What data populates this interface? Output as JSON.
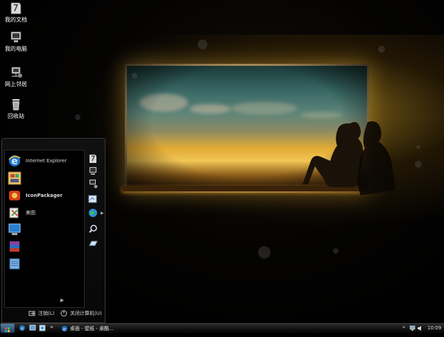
{
  "desktop_icons": [
    {
      "label": "我的文档",
      "icon": "my-documents-icon"
    },
    {
      "label": "我的电脑",
      "icon": "my-computer-icon"
    },
    {
      "label": "网上邻居",
      "icon": "network-places-icon"
    },
    {
      "label": "回收站",
      "icon": "recycle-bin-icon"
    }
  ],
  "start_menu": {
    "programs": [
      {
        "label": "Internet Explorer",
        "icon": "internet-explorer-icon"
      },
      {
        "label": "",
        "icon": "control-panel-icon"
      },
      {
        "label": "IconPackager",
        "icon": "iconpackager-icon"
      },
      {
        "label": "美图",
        "icon": "image-editor-icon"
      },
      {
        "label": "",
        "icon": "remote-desktop-icon"
      },
      {
        "label": "",
        "icon": "winrar-icon"
      },
      {
        "label": "",
        "icon": "notepad-icon"
      }
    ],
    "all_programs_arrow": "▶",
    "places": [
      {
        "icon": "documents-place-icon"
      },
      {
        "icon": "computer-place-icon"
      },
      {
        "icon": "network-place-icon"
      },
      {
        "icon": "control-panel-place-icon"
      },
      {
        "icon": "internet-place-icon"
      },
      {
        "icon": "search-place-icon"
      },
      {
        "icon": "run-place-icon"
      }
    ],
    "logoff_label": "注销(L)",
    "shutdown_label": "关闭计算机(U)"
  },
  "taskbar": {
    "quick_launch_more": "»",
    "task_label": "桌面 - 壁纸 - 桌酷...",
    "clock": "10:09",
    "tray_expand": "«"
  },
  "colors": {
    "window_glow": "#e2aa34",
    "start_menu_bg": "#070707",
    "taskbar_bg": "#101010"
  }
}
